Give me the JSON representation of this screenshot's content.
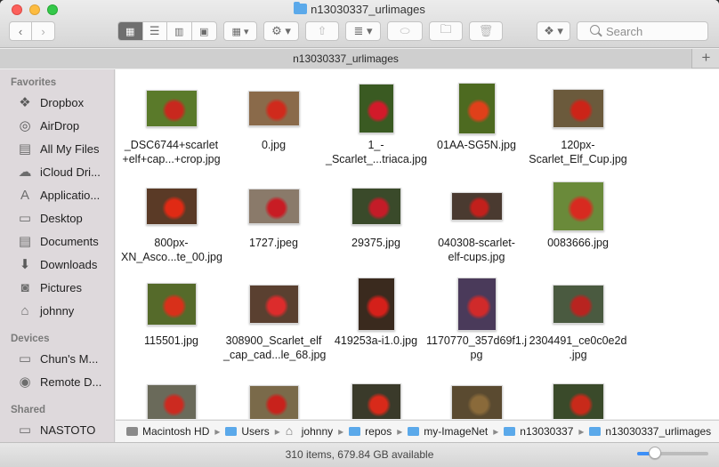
{
  "window": {
    "title": "n13030337_urlimages",
    "tab_label": "n13030337_urlimages",
    "tab_add": "+"
  },
  "toolbar": {
    "back_icon": "chevron-left-icon",
    "forward_icon": "chevron-right-icon",
    "view_icons": [
      "icon-view-icon",
      "list-view-icon",
      "column-view-icon",
      "cover-flow-icon"
    ],
    "group_icon": "group-icon",
    "action_icon": "gear-icon",
    "share_icon": "share-icon",
    "arrange_icon": "arrange-icon",
    "tag_icon": "tag-icon",
    "new_folder_icon": "new-folder-icon",
    "trash_icon": "trash-icon",
    "dropbox_icon": "dropbox-icon",
    "search_placeholder": "Search"
  },
  "sidebar": {
    "favorites_header": "Favorites",
    "favorites": [
      {
        "label": "Dropbox",
        "icon": "dropbox-icon"
      },
      {
        "label": "AirDrop",
        "icon": "airdrop-icon"
      },
      {
        "label": "All My Files",
        "icon": "all-files-icon"
      },
      {
        "label": "iCloud Dri...",
        "icon": "cloud-icon"
      },
      {
        "label": "Applicatio...",
        "icon": "applications-icon"
      },
      {
        "label": "Desktop",
        "icon": "desktop-icon"
      },
      {
        "label": "Documents",
        "icon": "documents-icon"
      },
      {
        "label": "Downloads",
        "icon": "downloads-icon"
      },
      {
        "label": "Pictures",
        "icon": "camera-icon"
      },
      {
        "label": "johnny",
        "icon": "home-icon"
      }
    ],
    "devices_header": "Devices",
    "devices": [
      {
        "label": "Chun's M...",
        "icon": "laptop-icon"
      },
      {
        "label": "Remote D...",
        "icon": "disc-icon"
      }
    ],
    "shared_header": "Shared",
    "shared": [
      {
        "label": "NASTOTO",
        "icon": "display-icon"
      }
    ]
  },
  "files": [
    {
      "name_lines": [
        "_DSC6744+scarlet",
        "+elf+cap...+crop.jpg"
      ],
      "colors": [
        "#5a7a2a",
        "#c8281e"
      ]
    },
    {
      "name_lines": [
        "0.jpg"
      ],
      "colors": [
        "#8a6a4a",
        "#d02a1c"
      ]
    },
    {
      "name_lines": [
        "1_-",
        "_Scarlet_...triaca.jpg"
      ],
      "colors": [
        "#3a5a22",
        "#d21a2a"
      ]
    },
    {
      "name_lines": [
        "01AA-SG5N.jpg"
      ],
      "colors": [
        "#4d6a20",
        "#e0401a"
      ]
    },
    {
      "name_lines": [
        "120px-",
        "Scarlet_Elf_Cup.jpg"
      ],
      "colors": [
        "#6b5a3c",
        "#cc2418"
      ]
    },
    {
      "name_lines": [
        "800px-",
        "XN_Asco...te_00.jpg"
      ],
      "colors": [
        "#5a3a26",
        "#e02a14"
      ]
    },
    {
      "name_lines": [
        "1727.jpeg"
      ],
      "colors": [
        "#8a7a6a",
        "#c81c24"
      ]
    },
    {
      "name_lines": [
        "29375.jpg"
      ],
      "colors": [
        "#3a4a2a",
        "#c41c28"
      ]
    },
    {
      "name_lines": [
        "040308-scarlet-",
        "elf-cups.jpg"
      ],
      "colors": [
        "#4a3a30",
        "#c2201c"
      ]
    },
    {
      "name_lines": [
        "0083666.jpg"
      ],
      "colors": [
        "#6a8a3a",
        "#d82a20"
      ]
    },
    {
      "name_lines": [
        "115501.jpg"
      ],
      "colors": [
        "#556a2a",
        "#d8301a"
      ]
    },
    {
      "name_lines": [
        "308900_Scarlet_elf",
        "_cap_cad...le_68.jpg"
      ],
      "colors": [
        "#5a4030",
        "#dc2c2c"
      ]
    },
    {
      "name_lines": [
        "419253a-i1.0.jpg"
      ],
      "colors": [
        "#3a2a1e",
        "#d4201a"
      ]
    },
    {
      "name_lines": [
        "1170770_357d69f1.j",
        "pg"
      ],
      "colors": [
        "#4a3a5a",
        "#d02a2a"
      ]
    },
    {
      "name_lines": [
        "2304491_ce0c0e2d",
        ".jpg"
      ],
      "colors": [
        "#4a5a40",
        "#b82420"
      ]
    },
    {
      "name_lines": [
        ""
      ],
      "colors": [
        "#6a6a5a",
        "#cc2a20"
      ]
    },
    {
      "name_lines": [
        ""
      ],
      "colors": [
        "#7a6a4a",
        "#c8221c"
      ]
    },
    {
      "name_lines": [
        ""
      ],
      "colors": [
        "#3a3a2a",
        "#d82a1a"
      ]
    },
    {
      "name_lines": [
        ""
      ],
      "colors": [
        "#5a4a30",
        "#8a6a3a"
      ]
    },
    {
      "name_lines": [
        ""
      ],
      "colors": [
        "#3a4a2a",
        "#c82a1a"
      ]
    }
  ],
  "path_bar": [
    {
      "label": "Macintosh HD",
      "icon": "hard-drive-icon"
    },
    {
      "label": "Users",
      "icon": "folder-icon"
    },
    {
      "label": "johnny",
      "icon": "home-icon"
    },
    {
      "label": "repos",
      "icon": "folder-icon"
    },
    {
      "label": "my-ImageNet",
      "icon": "folder-icon"
    },
    {
      "label": "n13030337",
      "icon": "folder-icon"
    },
    {
      "label": "n13030337_urlimages",
      "icon": "folder-icon"
    }
  ],
  "status": {
    "text": "310 items, 679.84 GB available",
    "icon_size_fraction": 0.25
  }
}
